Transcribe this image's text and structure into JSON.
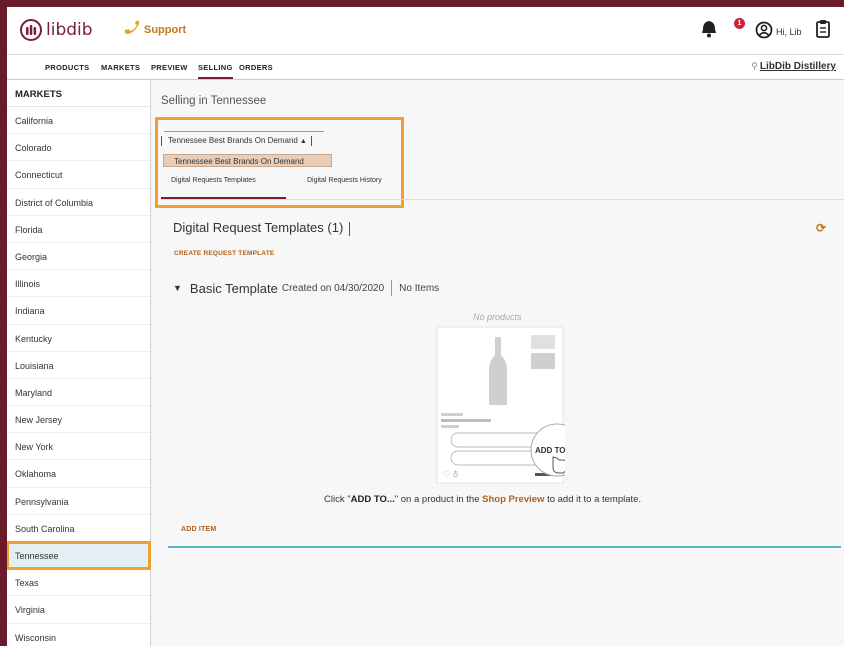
{
  "header": {
    "logo_text": "libdib",
    "support_label": "Support",
    "notification_count": "1",
    "user_greeting": "Hi, Lib"
  },
  "nav": {
    "items": [
      "PRODUCTS",
      "MARKETS",
      "PREVIEW",
      "SELLING",
      "ORDERS"
    ],
    "active": "SELLING",
    "distillery": "LibDib Distillery"
  },
  "sidebar": {
    "header": "MARKETS",
    "items": [
      "California",
      "Colorado",
      "Connecticut",
      "District of Columbia",
      "Florida",
      "Georgia",
      "Illinois",
      "Indiana",
      "Kentucky",
      "Louisiana",
      "Maryland",
      "New Jersey",
      "New York",
      "Oklahoma",
      "Pennsylvania",
      "South Carolina",
      "Tennessee",
      "Texas",
      "Virginia",
      "Wisconsin"
    ],
    "selected": "Tennessee"
  },
  "main": {
    "title": "Selling in Tennessee",
    "dropdown": {
      "current": "Tennessee Best Brands On Demand",
      "option": "Tennessee Best Brands On Demand"
    },
    "tabs": [
      "Digital Requests Templates",
      "Digital Requests History"
    ],
    "section_title": "Digital Request Templates (1)",
    "create_link": "CREATE REQUEST TEMPLATE",
    "template": {
      "name": "Basic Template",
      "created": "Created on 04/30/2020",
      "items": "No Items"
    },
    "no_products": "No products",
    "add_to_label": "ADD TO...",
    "hint_pre": "Click \"",
    "hint_bold": "ADD TO...",
    "hint_mid": "\" on a product in the ",
    "hint_shop": "Shop Preview",
    "hint_post": " to add it to a template.",
    "add_item": "ADD ITEM"
  },
  "colors": {
    "brand": "#7a1e33",
    "accent": "#c07a1c",
    "highlight": "#f0a030",
    "selected_bg": "#e4eff4",
    "teal": "#5bb7c7"
  }
}
